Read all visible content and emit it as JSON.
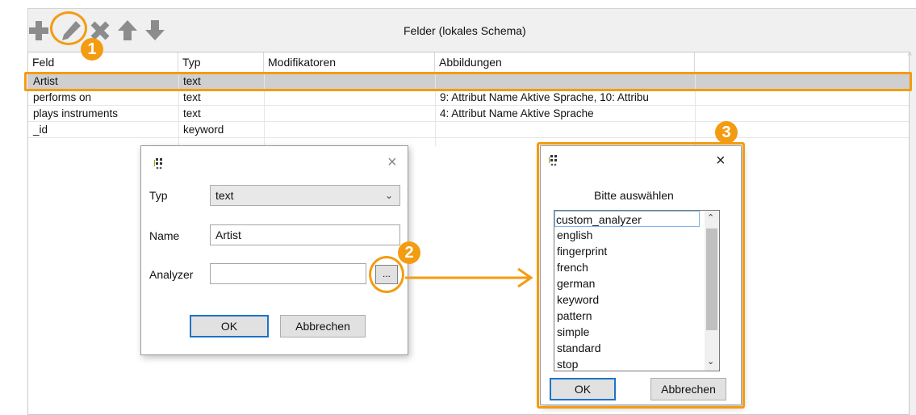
{
  "panel": {
    "title": "Felder (lokales Schema)"
  },
  "toolbar": {
    "buttons": [
      {
        "name": "add-field-button",
        "icon": "plus-icon"
      },
      {
        "name": "edit-field-button",
        "icon": "pencil-icon"
      },
      {
        "name": "delete-field-button",
        "icon": "x-icon"
      },
      {
        "name": "move-up-button",
        "icon": "arrow-up-icon"
      },
      {
        "name": "move-down-button",
        "icon": "arrow-down-icon"
      }
    ]
  },
  "table": {
    "headers": [
      "Feld",
      "Typ",
      "Modifikatoren",
      "Abbildungen",
      ""
    ],
    "rows": [
      {
        "feld": "Artist",
        "typ": "text",
        "modifikatoren": "",
        "abbildungen": "",
        "selected": true
      },
      {
        "feld": "performs on",
        "typ": "text",
        "modifikatoren": "",
        "abbildungen": "9: Attribut Name Aktive Sprache, 10: Attribu",
        "selected": false
      },
      {
        "feld": "plays instruments",
        "typ": "text",
        "modifikatoren": "",
        "abbildungen": "4: Attribut Name Aktive Sprache",
        "selected": false
      },
      {
        "feld": "_id",
        "typ": "keyword",
        "modifikatoren": "",
        "abbildungen": "",
        "selected": false
      }
    ]
  },
  "edit_dialog": {
    "close": "×",
    "typ_label": "Typ",
    "typ_value": "text",
    "name_label": "Name",
    "name_value": "Artist",
    "analyzer_label": "Analyzer",
    "analyzer_value": "",
    "browse_label": "...",
    "ok_label": "OK",
    "cancel_label": "Abbrechen"
  },
  "select_dialog": {
    "close": "×",
    "title": "Bitte auswählen",
    "options": [
      "custom_analyzer",
      "english",
      "fingerprint",
      "french",
      "german",
      "keyword",
      "pattern",
      "simple",
      "standard",
      "stop"
    ],
    "ok_label": "OK",
    "cancel_label": "Abbrechen"
  },
  "annotations": {
    "step1": "1",
    "step2": "2",
    "step3": "3"
  },
  "colors": {
    "accent": "#f39c12",
    "selected_row": "#cfcfcf",
    "toolbar_icon": "#8c8c8c",
    "primary_border": "#1e72c8"
  }
}
